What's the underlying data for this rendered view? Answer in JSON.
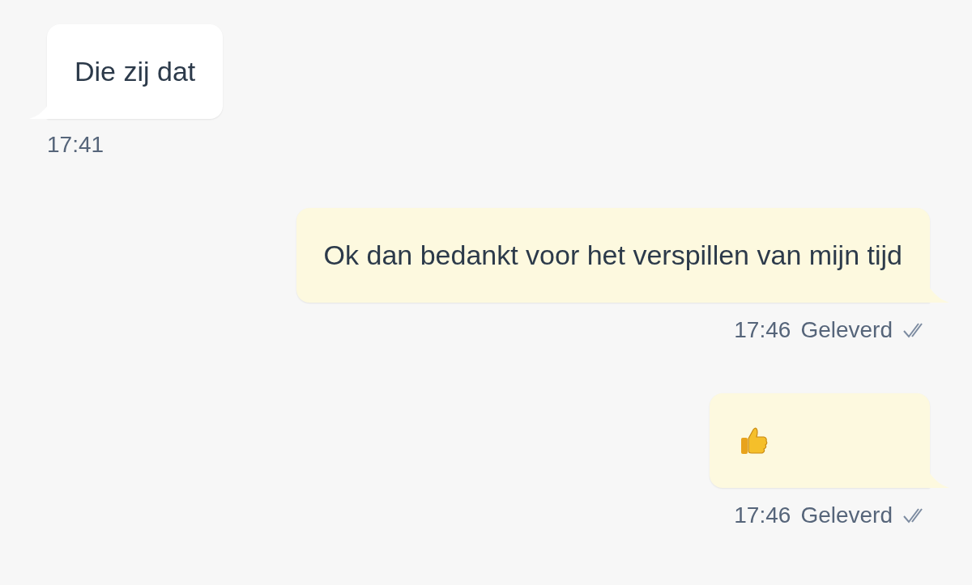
{
  "messages": [
    {
      "outgoing": false,
      "kind": "text",
      "text": "Die zij dat",
      "time": "17:41"
    },
    {
      "outgoing": true,
      "kind": "text",
      "text": "Ok dan bedankt voor het verspillen van mijn tijd",
      "time": "17:46",
      "status": "Geleverd"
    },
    {
      "outgoing": true,
      "kind": "icon",
      "time": "17:46",
      "status": "Geleverd"
    }
  ]
}
